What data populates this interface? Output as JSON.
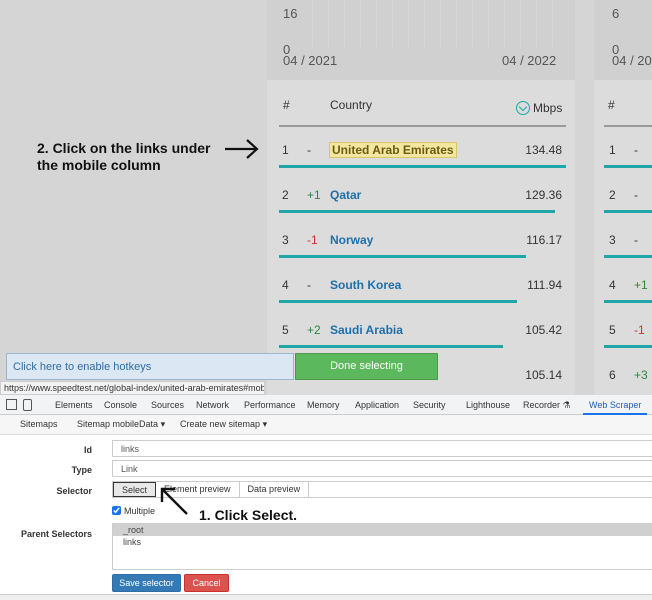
{
  "chart": {
    "y_top": "16",
    "y_zero": "0",
    "x_start": "04 / 2021",
    "x_end": "04 / 2022",
    "panel2_y_top": "6",
    "panel2_y_zero": "0",
    "panel2_x_start": "04 / 20"
  },
  "table": {
    "col_rank": "#",
    "col_country": "Country",
    "col_speed": "Mbps",
    "rows": [
      {
        "rank": "1",
        "change": "-",
        "country": "United Arab Emirates",
        "speed": "134.48"
      },
      {
        "rank": "2",
        "change": "+1",
        "country": "Qatar",
        "speed": "129.36"
      },
      {
        "rank": "3",
        "change": "-1",
        "country": "Norway",
        "speed": "116.17"
      },
      {
        "rank": "4",
        "change": "-",
        "country": "South Korea",
        "speed": "111.94"
      },
      {
        "rank": "5",
        "change": "+2",
        "country": "Saudi Arabia",
        "speed": "105.42"
      },
      {
        "rank": "",
        "change": "",
        "country": "",
        "speed": "105.14"
      }
    ]
  },
  "table2": {
    "col_rank": "#",
    "rows": [
      {
        "rank": "1",
        "change": "-"
      },
      {
        "rank": "2",
        "change": "-"
      },
      {
        "rank": "3",
        "change": "-"
      },
      {
        "rank": "4",
        "change": "+1"
      },
      {
        "rank": "5",
        "change": "-1"
      },
      {
        "rank": "6",
        "change": "+3"
      }
    ]
  },
  "annotations": {
    "step2_line1": "2. Click on the links under",
    "step2_line2": "the mobile column",
    "step1": "1. Click Select."
  },
  "selection_bar": {
    "hotkeys": "Click here to enable hotkeys",
    "done": "Done selecting"
  },
  "status_url": "https://www.speedtest.net/global-index/united-arab-emirates#mobile",
  "devtools": {
    "tabs": [
      "Elements",
      "Console",
      "Sources",
      "Network",
      "Performance",
      "Memory",
      "Application",
      "Security",
      "Lighthouse",
      "Recorder",
      "Web Scraper"
    ],
    "active_tab": "Web Scraper",
    "subtabs": [
      "Sitemaps",
      "Sitemap mobileData",
      "Create new sitemap"
    ]
  },
  "form": {
    "id_label": "Id",
    "id_value": "links",
    "type_label": "Type",
    "type_value": "Link",
    "selector_label": "Selector",
    "select_btn": "Select",
    "element_preview": "Element preview",
    "data_preview": "Data preview",
    "multiple_label": "Multiple",
    "parent_label": "Parent Selectors",
    "parent_options": [
      "_root",
      "links"
    ],
    "save": "Save selector",
    "cancel": "Cancel"
  },
  "colors": {
    "bar": "#1fa6a8",
    "link": "#1f6fa8",
    "done_green": "#5cb85c",
    "save_blue": "#337ab7",
    "cancel_red": "#d9534f"
  }
}
